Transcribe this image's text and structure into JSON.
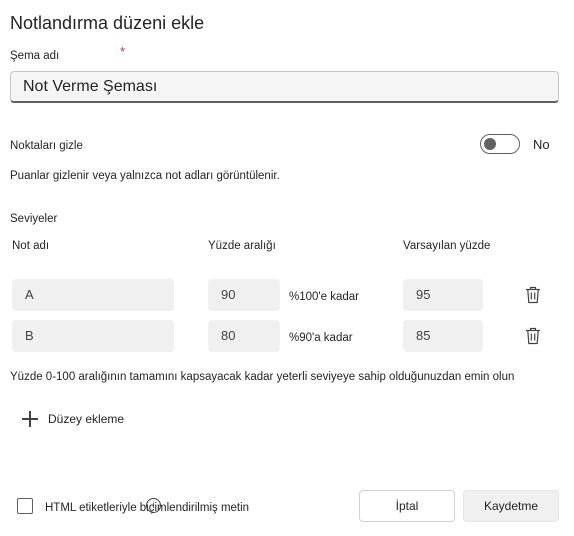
{
  "dialog": {
    "title": "Notlandırma düzeni ekle",
    "scheme_name_label": "Şema adı",
    "required_marker": "*",
    "scheme_name_value": "Not Verme Şeması",
    "hide_points_label": "Noktaları gizle",
    "hide_points_toggle_text": "No",
    "hide_points_description": "Puanlar gizlenir veya yalnızca not adları görüntülenir.",
    "levels_label": "Seviyeler",
    "columns": {
      "grade_name": "Not adı",
      "percent_range": "Yüzde aralığı",
      "default_percent": "Varsayılan yüzde"
    },
    "levels": [
      {
        "name": "A",
        "range_from": "90",
        "range_to_label": "%100'e kadar",
        "default_percent": "95"
      },
      {
        "name": "B",
        "range_from": "80",
        "range_to_label": "%90'a kadar",
        "default_percent": "85"
      }
    ],
    "coverage_note": "Yüzde 0-100 aralığının tamamını kapsayacak kadar yeterli seviyeye sahip olduğunuzdan emin olun",
    "add_level_label": "Düzey ekleme",
    "html_checkbox_label": "HTML etiketleriyle biçimlendirilmiş metin",
    "info_icon_glyph": "i",
    "cancel_label": "İptal",
    "save_label": "Kaydetme"
  },
  "colors": {
    "required": "#c4314b",
    "field_background": "#f0f0f0",
    "toggle_off": "#616161"
  }
}
